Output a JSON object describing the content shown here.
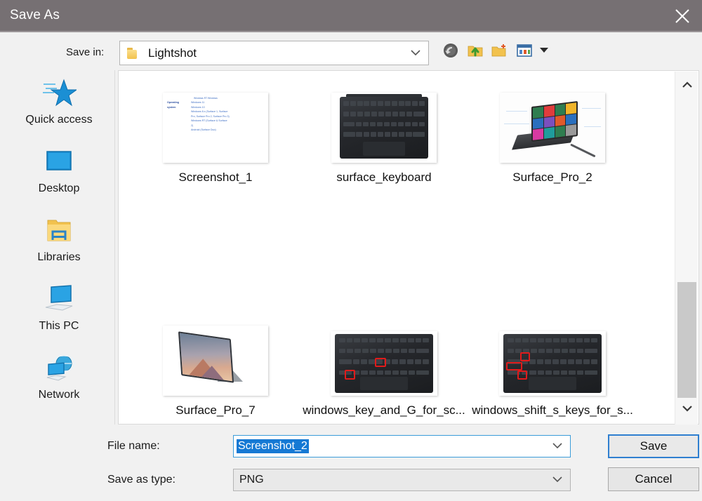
{
  "window": {
    "title": "Save As",
    "close_icon": "close-icon"
  },
  "savein": {
    "label": "Save in:",
    "value": "Lightshot",
    "folder_icon": "folder-icon",
    "chevron_icon": "chevron-down-icon"
  },
  "toolbar": {
    "items": [
      {
        "name": "back-button",
        "icon": "back-arrow-icon",
        "title": "Back"
      },
      {
        "name": "up-one-level-button",
        "icon": "up-folder-icon",
        "title": "Up One Level"
      },
      {
        "name": "new-folder-button",
        "icon": "new-folder-icon",
        "title": "Create New Folder"
      },
      {
        "name": "views-button",
        "icon": "views-icon",
        "title": "Views"
      }
    ],
    "views_caret_icon": "caret-down-icon"
  },
  "places": {
    "items": [
      {
        "label": "Quick access",
        "icon": "star-icon"
      },
      {
        "label": "Desktop",
        "icon": "monitor-icon"
      },
      {
        "label": "Libraries",
        "icon": "libraries-folder-icon"
      },
      {
        "label": "This PC",
        "icon": "this-pc-icon"
      },
      {
        "label": "Network",
        "icon": "network-globe-icon"
      }
    ]
  },
  "files": {
    "items": [
      {
        "label": "Screenshot_1",
        "kind": "wiki-infobox-thumbnail"
      },
      {
        "label": "surface_keyboard",
        "kind": "keyboard-thumbnail"
      },
      {
        "label": "Surface_Pro_2",
        "kind": "surface-pro-2-thumbnail"
      },
      {
        "label": "Surface_Pro_7",
        "kind": "surface-pro-7-thumbnail"
      },
      {
        "label": "windows_key_and_G_for_sc...",
        "kind": "keyboard-marked-thumbnail"
      },
      {
        "label": "windows_shift_s_keys_for_s...",
        "kind": "keyboard-marked-thumbnail"
      }
    ]
  },
  "thumbnail_1": {
    "top_text": "Windows RT  Windows",
    "rows": [
      {
        "key": "Operating",
        "value": "Windows 11"
      },
      {
        "key": "system",
        "value": "Windows 10"
      },
      {
        "key": "",
        "value": "Windows 8.x (Surface 1, Surface"
      },
      {
        "key": "",
        "value": "Pro, Surface Pro 2, Surface Pro 3)"
      },
      {
        "key": "",
        "value": "Windows RT (Surface & Surface"
      },
      {
        "key": "",
        "value": "2)"
      },
      {
        "key": "",
        "value": "Android (Surface Duo)"
      }
    ]
  },
  "fields": {
    "filename_label": "File name:",
    "filename_value": "Screenshot_2",
    "filetype_label": "Save as type:",
    "filetype_value": "PNG",
    "filename_chevron_icon": "chevron-down-icon",
    "filetype_chevron_icon": "chevron-down-icon"
  },
  "buttons": {
    "save": "Save",
    "cancel": "Cancel"
  },
  "scrollbar": {
    "up_icon": "chevron-up-icon",
    "down_icon": "chevron-down-icon"
  },
  "colors": {
    "titlebar": "#767073",
    "accent": "#1579d4",
    "focus_border": "#2f7fd0",
    "dialog_bg": "#f1f1f1",
    "list_bg": "#ffffff",
    "mark_red": "#e01b1b"
  }
}
